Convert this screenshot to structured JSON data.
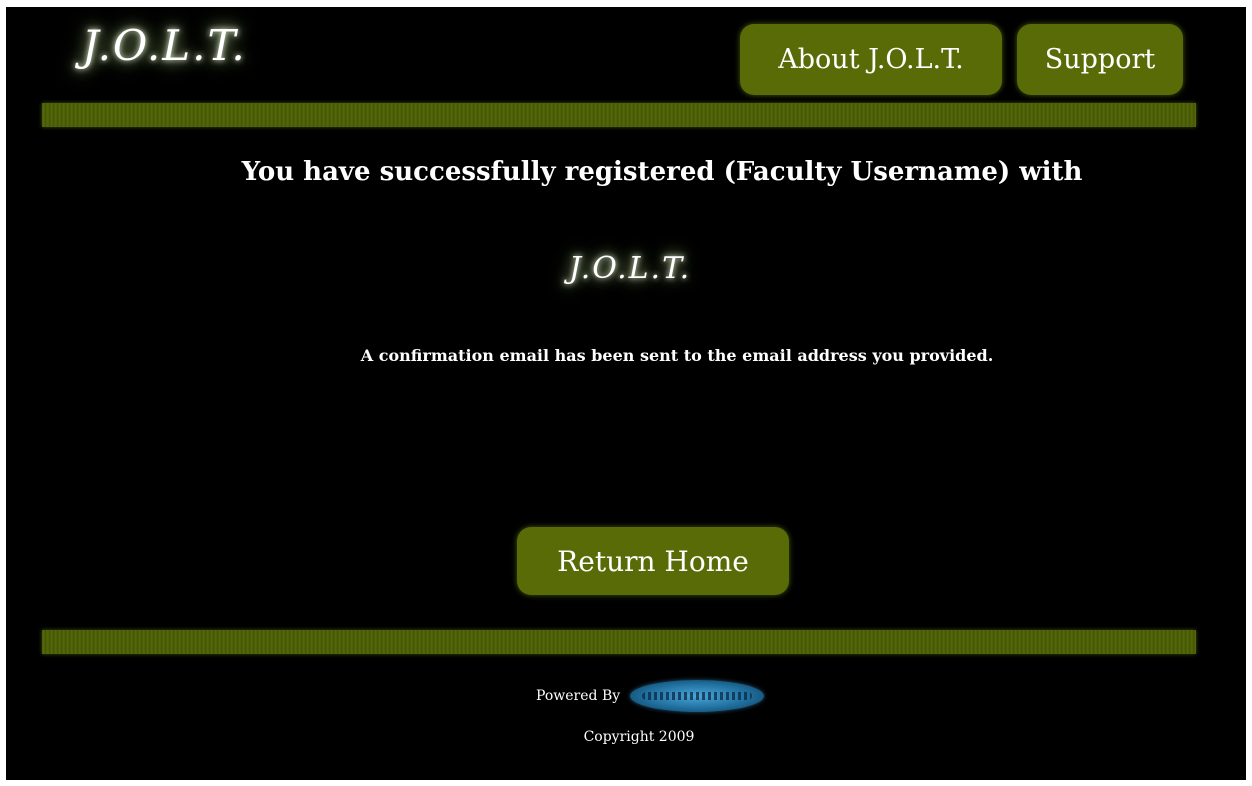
{
  "header": {
    "logo_text": "J.O.L.T.",
    "nav": {
      "about_label": "About J.O.L.T.",
      "support_label": "Support"
    }
  },
  "main": {
    "heading": "You have successfully registered (Faculty Username) with",
    "logo_text": "J.O.L.T.",
    "confirmation_text": "A confirmation email has been sent to the email address you provided.",
    "return_home_label": "Return Home"
  },
  "footer": {
    "powered_by_label": "Powered By",
    "sponsor_logo_icon": "sponsor-logo-icon",
    "copyright": "Copyright 2009"
  },
  "colors": {
    "background": "#000000",
    "button_fill": "#596b06",
    "bar_fill": "#4a5c06",
    "text": "#ffffff",
    "logo_glow": "#a9c48a"
  }
}
